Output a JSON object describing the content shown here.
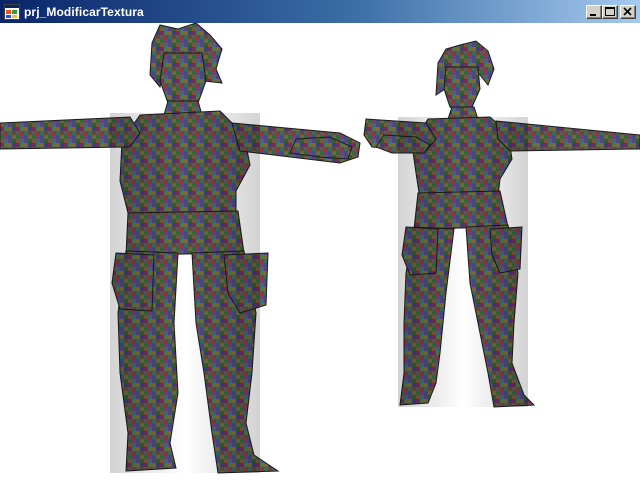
{
  "window": {
    "title": "prj_ModificarTextura",
    "icon": "windows-app-icon",
    "controls": {
      "minimize": "minimize-icon",
      "maximize": "maximize-icon",
      "close": "close-icon"
    }
  },
  "viewport": {
    "background": "#ffffff",
    "models": [
      {
        "name": "character-model-large",
        "texture": "random-noise"
      },
      {
        "name": "character-model-small",
        "texture": "random-noise"
      }
    ]
  }
}
